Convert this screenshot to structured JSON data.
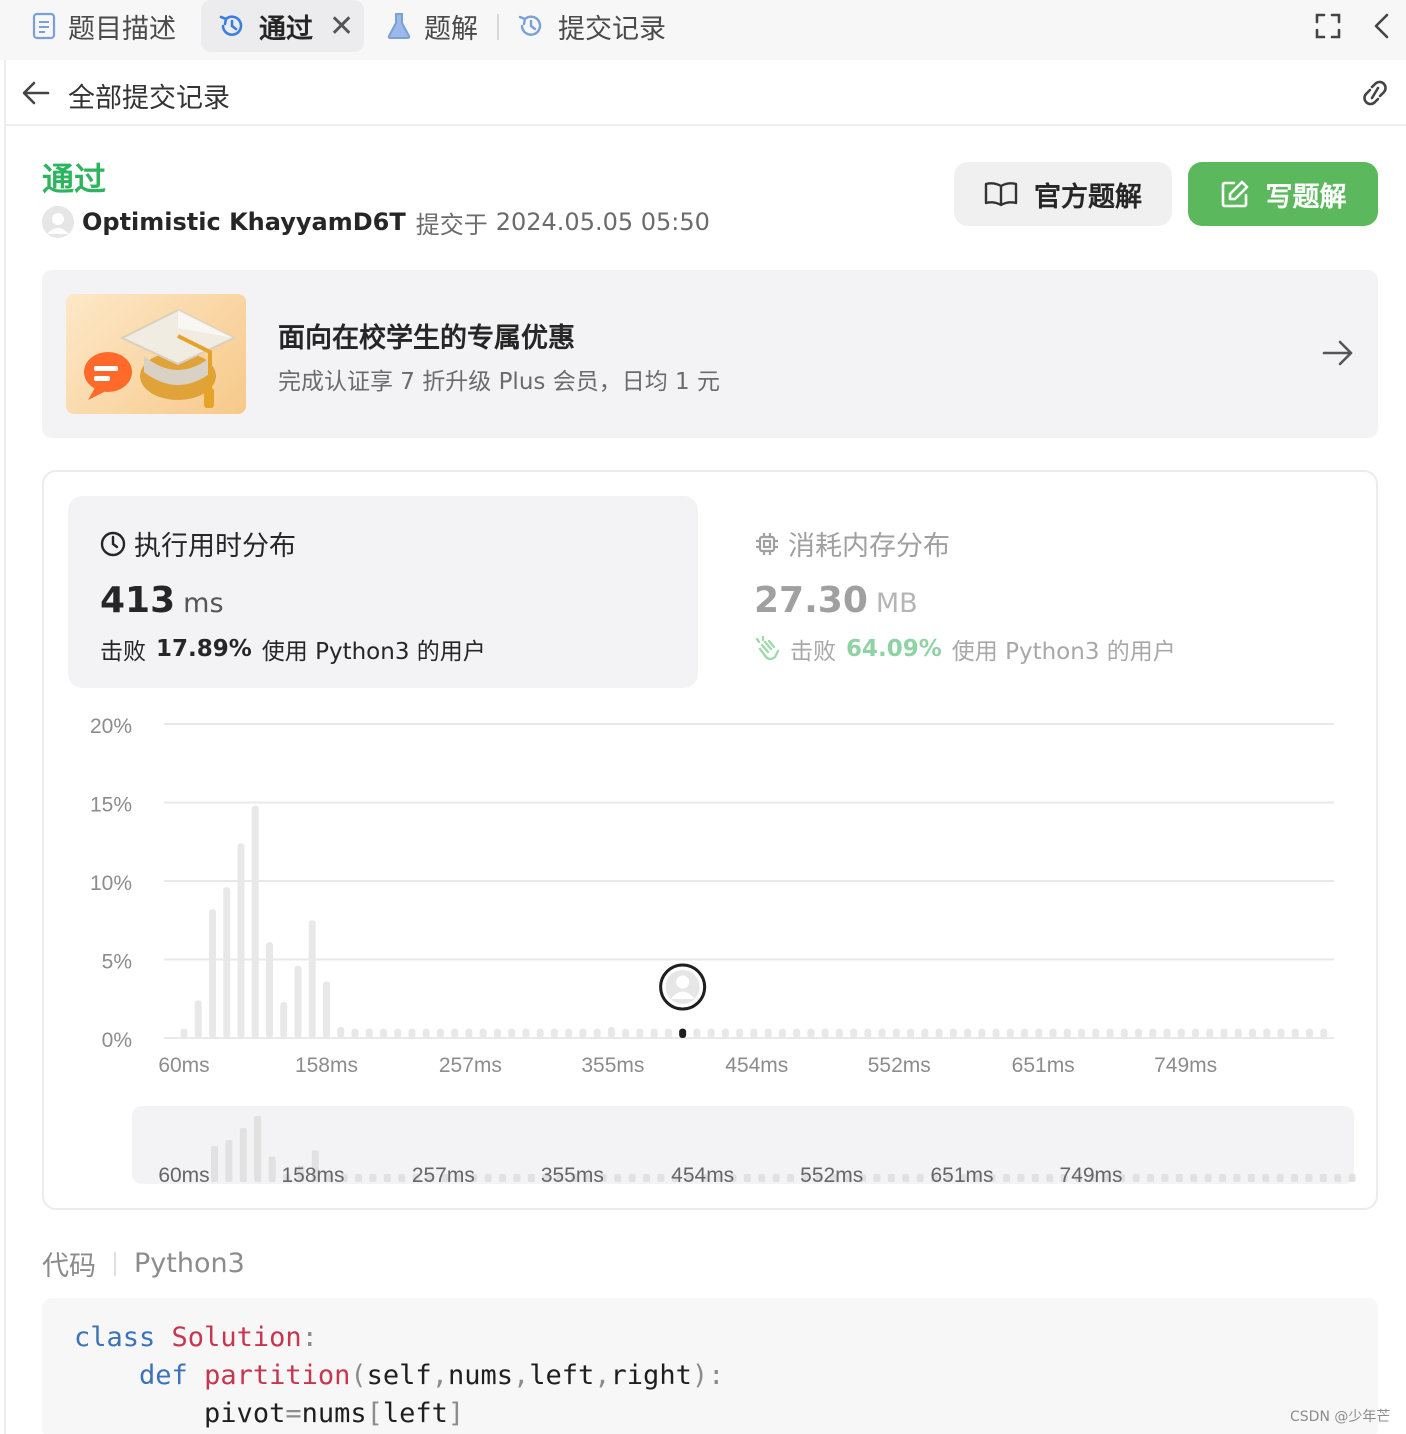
{
  "tabs": [
    {
      "label": "题目描述",
      "icon": "document-icon"
    },
    {
      "label": "通过",
      "icon": "history-icon",
      "active": true
    },
    {
      "label": "题解",
      "icon": "flask-icon"
    },
    {
      "label": "提交记录",
      "icon": "history-icon"
    }
  ],
  "tab_close": "✕",
  "subheader": {
    "back_label": "全部提交记录"
  },
  "submission": {
    "status": "通过",
    "user": "Optimistic KhayyamD6T",
    "submitted_prefix": "提交于",
    "submitted_at": "2024.05.05 05:50"
  },
  "buttons": {
    "official": "官方题解",
    "write": "写题解"
  },
  "promo": {
    "title": "面向在校学生的专属优惠",
    "subtitle": "完成认证享 7 折升级 Plus 会员，日均 1 元"
  },
  "runtime": {
    "title": "执行用时分布",
    "value": "413",
    "unit": "ms",
    "beat_prefix": "击败",
    "beat_pct": "17.89%",
    "beat_suffix": "使用 Python3 的用户"
  },
  "memory": {
    "title": "消耗内存分布",
    "value": "27.30",
    "unit": "MB",
    "beat_prefix": "击败",
    "beat_pct": "64.09%",
    "beat_suffix": "使用 Python3 的用户"
  },
  "colors": {
    "accent_green": "#2db55d",
    "button_green": "#5cb85c",
    "memory_green": "#8fd3a4",
    "bar_gray": "#e8e8e8"
  },
  "chart_data": {
    "type": "bar",
    "title": "",
    "xlabel": "",
    "ylabel": "",
    "ylim": [
      0,
      20
    ],
    "y_ticks": [
      "20%",
      "15%",
      "10%",
      "5%",
      "0%"
    ],
    "x_ticks": [
      "60ms",
      "158ms",
      "257ms",
      "355ms",
      "454ms",
      "552ms",
      "651ms",
      "749ms"
    ],
    "x_range_ms": [
      60,
      850
    ],
    "bin_width_ms": 9.8,
    "values": [
      0.6,
      2.4,
      8.2,
      9.6,
      12.4,
      14.8,
      6.1,
      2.3,
      4.6,
      7.5,
      3.6,
      0.7,
      0.6,
      0.6,
      0.6,
      0.6,
      0.6,
      0.6,
      0.6,
      0.6,
      0.6,
      0.6,
      0.6,
      0.6,
      0.6,
      0.6,
      0.6,
      0.6,
      0.6,
      0.6,
      0.7,
      0.6,
      0.6,
      0.6,
      0.6,
      0.6,
      0.6,
      0.6,
      0.6,
      0.6,
      0.6,
      0.6,
      0.6,
      0.6,
      0.6,
      0.6,
      0.6,
      0.6,
      0.6,
      0.6,
      0.6,
      0.6,
      0.6,
      0.6,
      0.6,
      0.6,
      0.6,
      0.6,
      0.6,
      0.6,
      0.6,
      0.6,
      0.6,
      0.6,
      0.6,
      0.6,
      0.6,
      0.6,
      0.6,
      0.6,
      0.6,
      0.6,
      0.6,
      0.6,
      0.6,
      0.6,
      0.6,
      0.6,
      0.6,
      0.6,
      0.6
    ],
    "highlight_index": 35,
    "user_marker_ms": 413,
    "grid": true,
    "overview_values": [
      0,
      0,
      0,
      0,
      0,
      2.4,
      2.8,
      3.6,
      4.4,
      1.7,
      0.4,
      1.1,
      2.1,
      0.4,
      0.4,
      0.4,
      0.4,
      0.4,
      0.4,
      0.4,
      0.4,
      0.4,
      0.4,
      0.4,
      0.4,
      0.4,
      0.4,
      0.4,
      0.4,
      0.4,
      0.4,
      0.4,
      0.4,
      0.4,
      0.4,
      0.4,
      0.4,
      0.4,
      0.4,
      0.4,
      0.4,
      0.4,
      0.4,
      0.4,
      0.4,
      0.4,
      0.4,
      0.4,
      0.4,
      0.4,
      0.4,
      0.4,
      0.4,
      0.4,
      0.4,
      0.4,
      0.4,
      0.4,
      0.4,
      0.4,
      0.4,
      0.4,
      0.4,
      0.4,
      0.4,
      0.4,
      0.4,
      0.4,
      0.4,
      0.4,
      0.4,
      0.4,
      0.4,
      0.4,
      0.4,
      0.4,
      0.4,
      0.4,
      0.4,
      0.4,
      0.4,
      0.4,
      0.4,
      0.4,
      0.4
    ]
  },
  "code": {
    "label": "代码",
    "language": "Python3",
    "lines": [
      {
        "indent": "",
        "tokens": [
          [
            "kw",
            "class"
          ],
          [
            "sp",
            " "
          ],
          [
            "fn",
            "Solution"
          ],
          [
            "pn",
            ":"
          ]
        ]
      },
      {
        "indent": "    ",
        "tokens": [
          [
            "kw",
            "def"
          ],
          [
            "sp",
            " "
          ],
          [
            "fn",
            "partition"
          ],
          [
            "pn",
            "("
          ],
          [
            "tx",
            "self"
          ],
          [
            "pn",
            ","
          ],
          [
            "tx",
            "nums"
          ],
          [
            "pn",
            ","
          ],
          [
            "tx",
            "left"
          ],
          [
            "pn",
            ","
          ],
          [
            "tx",
            "right"
          ],
          [
            "pn",
            "):"
          ]
        ]
      },
      {
        "indent": "        ",
        "tokens": [
          [
            "tx",
            "pivot"
          ],
          [
            "pn",
            "="
          ],
          [
            "tx",
            "nums"
          ],
          [
            "pn",
            "["
          ],
          [
            "tx",
            "left"
          ],
          [
            "pn",
            "]"
          ]
        ]
      }
    ]
  },
  "watermark": "CSDN @少年芒"
}
